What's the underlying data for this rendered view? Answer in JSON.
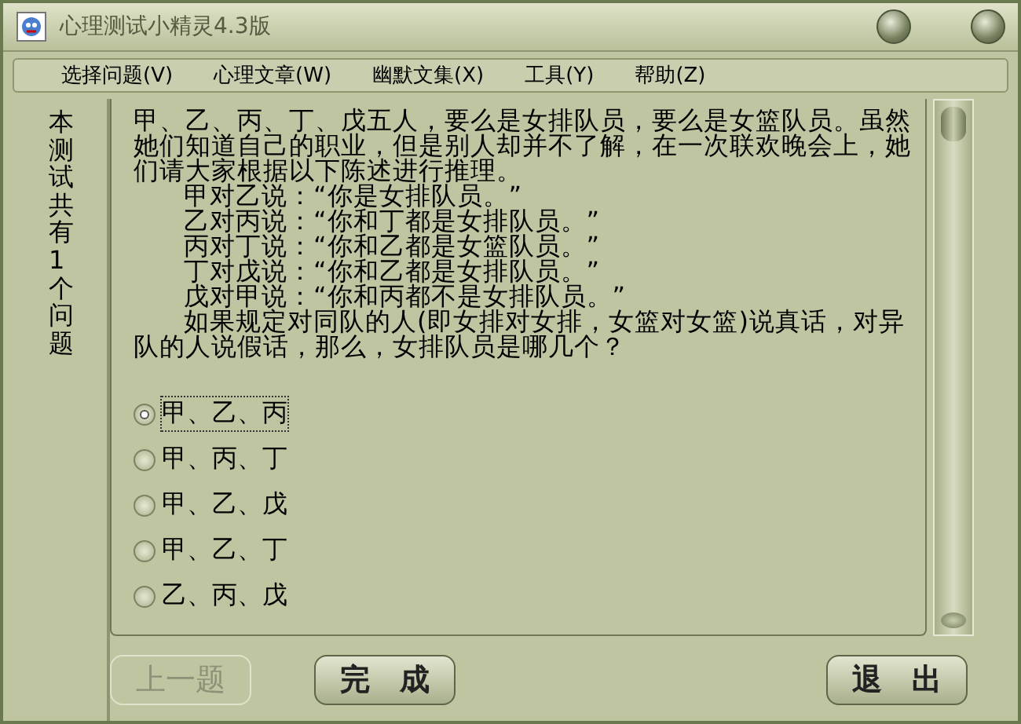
{
  "window": {
    "title": "心理测试小精灵4.3版"
  },
  "menu": [
    "选择问题(V)",
    "心理文章(W)",
    "幽默文集(X)",
    "工具(Y)",
    "帮助(Z)"
  ],
  "sidebar": {
    "text": "本测试共有1个问题"
  },
  "question": {
    "paragraphs": [
      {
        "text": "甲、乙、丙、丁、戊五人，要么是女排队员，要么是女篮队员。虽然她们知道自己的职业，但是别人却并不了解，在一次联欢晚会上，她们请大家根据以下陈述进行推理。",
        "indented": false
      },
      {
        "text": "甲对乙说：“你是女排队员。”",
        "indented": true
      },
      {
        "text": "乙对丙说：“你和丁都是女排队员。”",
        "indented": true
      },
      {
        "text": "丙对丁说：“你和乙都是女篮队员。”",
        "indented": true
      },
      {
        "text": "丁对戊说：“你和乙都是女排队员。”",
        "indented": true
      },
      {
        "text": "戊对甲说：“你和丙都不是女排队员。”",
        "indented": true
      },
      {
        "text": "如果规定对同队的人(即女排对女排，女篮对女篮)说真话，对异队的人说假话，那么，女排队员是哪几个？",
        "indented": true
      }
    ]
  },
  "options": [
    {
      "label": "甲、乙、丙",
      "selected": true
    },
    {
      "label": "甲、丙、丁",
      "selected": false
    },
    {
      "label": "甲、乙、戊",
      "selected": false
    },
    {
      "label": "甲、乙、丁",
      "selected": false
    },
    {
      "label": "乙、丙、戊",
      "selected": false
    }
  ],
  "buttons": [
    {
      "label": "上一题",
      "disabled": true
    },
    {
      "label": "完　成",
      "disabled": false
    },
    {
      "label": "退　出",
      "disabled": false
    }
  ]
}
